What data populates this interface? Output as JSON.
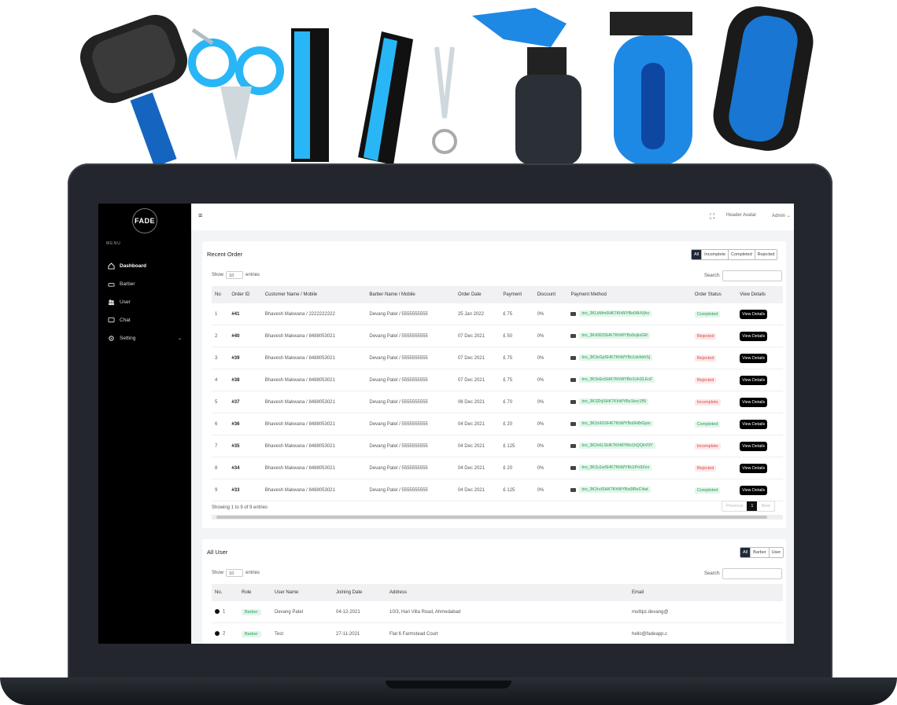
{
  "brand": {
    "logo": "FADE"
  },
  "sidebar": {
    "menu_label": "MENU",
    "items": [
      {
        "label": "Dashboard",
        "icon": "home-icon"
      },
      {
        "label": "Barber",
        "icon": "car-icon"
      },
      {
        "label": "User",
        "icon": "users-icon"
      },
      {
        "label": "Chat",
        "icon": "chat-icon"
      },
      {
        "label": "Setting",
        "icon": "gear-icon"
      }
    ]
  },
  "header": {
    "hamburger": "≡",
    "avatar_alt": "Header Avatar",
    "user": "Admin"
  },
  "orders": {
    "title": "Recent Order",
    "filters": [
      "All",
      "Incomplete",
      "Completed",
      "Rejected"
    ],
    "show_label": "Show",
    "show_value": "10",
    "entries_label": "entries",
    "search_label": "Search:",
    "columns": [
      "No",
      "Order ID",
      "Customer Name / Mobile",
      "Barber Name / Mobile",
      "Order Date",
      "Payment",
      "Discount",
      "Payment Method",
      "Order Status",
      "View Details"
    ],
    "rows": [
      {
        "no": "1",
        "id": "#41",
        "customer": "Bhavesh Makwana / 2222222222",
        "barber": "Devang Patel / 5555555555",
        "date": "25 Jan 2022",
        "payment": "£ 75",
        "discount": "0%",
        "method": "txn_3KLkMm5HK7KhWYBo04HVjhv",
        "status": "Completed"
      },
      {
        "no": "2",
        "id": "#40",
        "customer": "Bhavesh Makwana / 8488053021",
        "barber": "Devang Patel / 5555555555",
        "date": "07 Dec 2021",
        "payment": "£ 50",
        "discount": "0%",
        "method": "txn_3K4363SHK7KhWYBo0vjkxGR",
        "status": "Rejected"
      },
      {
        "no": "3",
        "id": "#39",
        "customer": "Bhavesh Makwana / 8488053021",
        "barber": "Devang Patel / 5555555555",
        "date": "07 Dec 2021",
        "payment": "£ 75",
        "discount": "0%",
        "method": "txn_3K3xGpSHK7KhWYBo1dvhbhSj",
        "status": "Rejected"
      },
      {
        "no": "4",
        "id": "#38",
        "customer": "Bhavesh Makwana / 8488053021",
        "barber": "Devang Patel / 5555555555",
        "date": "07 Dec 2021",
        "payment": "£ 75",
        "discount": "0%",
        "method": "txn_3K3xEoSHK7KhWYBo1UH2LEcF",
        "status": "Rejected"
      },
      {
        "no": "5",
        "id": "#37",
        "customer": "Bhavesh Makwana / 8488053021",
        "barber": "Devang Patel / 5555555555",
        "date": "06 Dec 2021",
        "payment": "£ 70",
        "discount": "0%",
        "method": "txn_3K3ZhjSHK7KhWYBo1kxc1f5l",
        "status": "Incomplete"
      },
      {
        "no": "6",
        "id": "#36",
        "customer": "Bhavesh Makwana / 8488053021",
        "barber": "Devang Patel / 5555555555",
        "date": "04 Dec 2021",
        "payment": "£ 20",
        "discount": "0%",
        "method": "txn_3K2x9GSHK7KhWYBo0H8rGpio",
        "status": "Completed"
      },
      {
        "no": "7",
        "id": "#35",
        "customer": "Bhavesh Makwana / 8488053021",
        "barber": "Devang Patel / 5555555555",
        "date": "04 Dec 2021",
        "payment": "£ 125",
        "discount": "0%",
        "method": "txn_3K2x6LSHK7KhWYBo1hQQkV0Y",
        "status": "Incomplete"
      },
      {
        "no": "8",
        "id": "#34",
        "customer": "Bhavesh Makwana / 8488053021",
        "barber": "Devang Patel / 5555555555",
        "date": "04 Dec 2021",
        "payment": "£ 20",
        "discount": "0%",
        "method": "txn_3K2u1wSHK7KhWYBo1Po9Zex",
        "status": "Rejected"
      },
      {
        "no": "9",
        "id": "#33",
        "customer": "Bhavesh Makwana / 8488053021",
        "barber": "Devang Patel / 5555555555",
        "date": "04 Dec 2021",
        "payment": "£ 125",
        "discount": "0%",
        "method": "txn_3K2ruISHK7KhWYBo0fReC4wt",
        "status": "Completed"
      }
    ],
    "view_label": "View Details",
    "info": "Showing 1 to 9 of 9 entries",
    "pager": {
      "prev": "Previous",
      "page": "1",
      "next": "Next"
    }
  },
  "users": {
    "title": "All User",
    "filters": [
      "All",
      "Barber",
      "User"
    ],
    "show_label": "Show",
    "show_value": "10",
    "entries_label": "entries",
    "search_label": "Search:",
    "columns": [
      "No.",
      "Role",
      "User Name",
      "Joining Date",
      "Address",
      "Email"
    ],
    "rows": [
      {
        "no": "1",
        "role": "Barber",
        "name": "Devang Patel",
        "date": "04-12-2021",
        "address": "10/3, Hari Villa Road, Ahmedabad",
        "email": "multipz.devang@"
      },
      {
        "no": "2",
        "role": "Barber",
        "name": "Test",
        "date": "27-11-2021",
        "address": "Flat 6 Farmstead Court",
        "email": "hello@fadeapp.c"
      }
    ]
  }
}
